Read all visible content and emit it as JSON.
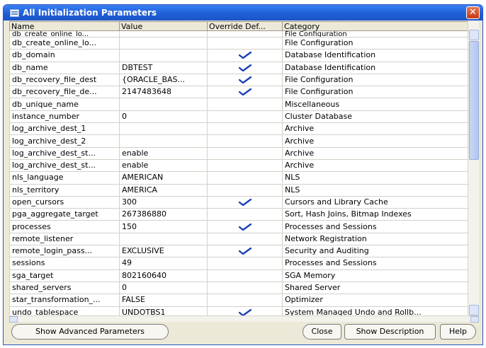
{
  "window": {
    "title": "All Initialization Parameters",
    "close_glyph": "✕"
  },
  "table": {
    "columns": {
      "name": "Name",
      "value": "Value",
      "override": "Override Def...",
      "category": "Category"
    },
    "partial_row": {
      "name": "db_create_online_lo...",
      "value": "",
      "override": false,
      "category": "File Configuration"
    },
    "rows": [
      {
        "name": "db_create_online_lo...",
        "value": "",
        "override": false,
        "category": "File Configuration"
      },
      {
        "name": "db_domain",
        "value": "",
        "override": true,
        "category": "Database Identification"
      },
      {
        "name": "db_name",
        "value": "DBTEST",
        "override": true,
        "category": "Database Identification"
      },
      {
        "name": "db_recovery_file_dest",
        "value": "{ORACLE_BAS...",
        "override": true,
        "category": "File Configuration"
      },
      {
        "name": "db_recovery_file_de...",
        "value": "2147483648",
        "override": true,
        "category": "File Configuration"
      },
      {
        "name": "db_unique_name",
        "value": "",
        "override": false,
        "category": "Miscellaneous"
      },
      {
        "name": "instance_number",
        "value": "0",
        "override": false,
        "category": "Cluster Database"
      },
      {
        "name": "log_archive_dest_1",
        "value": "",
        "override": false,
        "category": "Archive"
      },
      {
        "name": "log_archive_dest_2",
        "value": "",
        "override": false,
        "category": "Archive"
      },
      {
        "name": "log_archive_dest_st...",
        "value": "enable",
        "override": false,
        "category": "Archive"
      },
      {
        "name": "log_archive_dest_st...",
        "value": "enable",
        "override": false,
        "category": "Archive"
      },
      {
        "name": "nls_language",
        "value": "AMERICAN",
        "override": false,
        "category": "NLS"
      },
      {
        "name": "nls_territory",
        "value": "AMERICA",
        "override": false,
        "category": "NLS"
      },
      {
        "name": "open_cursors",
        "value": "300",
        "override": true,
        "category": "Cursors and Library Cache"
      },
      {
        "name": "pga_aggregate_target",
        "value": "267386880",
        "override": false,
        "category": "Sort, Hash Joins, Bitmap Indexes"
      },
      {
        "name": "processes",
        "value": "150",
        "override": true,
        "category": "Processes and Sessions"
      },
      {
        "name": "remote_listener",
        "value": "",
        "override": false,
        "category": "Network Registration"
      },
      {
        "name": "remote_login_pass...",
        "value": "EXCLUSIVE",
        "override": true,
        "category": "Security and Auditing"
      },
      {
        "name": "sessions",
        "value": "49",
        "override": false,
        "category": "Processes and Sessions"
      },
      {
        "name": "sga_target",
        "value": "802160640",
        "override": false,
        "category": "SGA Memory"
      },
      {
        "name": "shared_servers",
        "value": "0",
        "override": false,
        "category": "Shared Server"
      },
      {
        "name": "star_transformation_...",
        "value": "FALSE",
        "override": false,
        "category": "Optimizer"
      },
      {
        "name": "undo_tablespace",
        "value": "UNDOTBS1",
        "override": true,
        "category": "System Managed Undo and Rollb..."
      }
    ]
  },
  "buttons": {
    "show_advanced": "Show Advanced Parameters",
    "close": "Close",
    "show_description": "Show Description",
    "help": "Help"
  },
  "colors": {
    "checkmark": "#1a3fb8",
    "titlebar": "#1f5fd6"
  }
}
